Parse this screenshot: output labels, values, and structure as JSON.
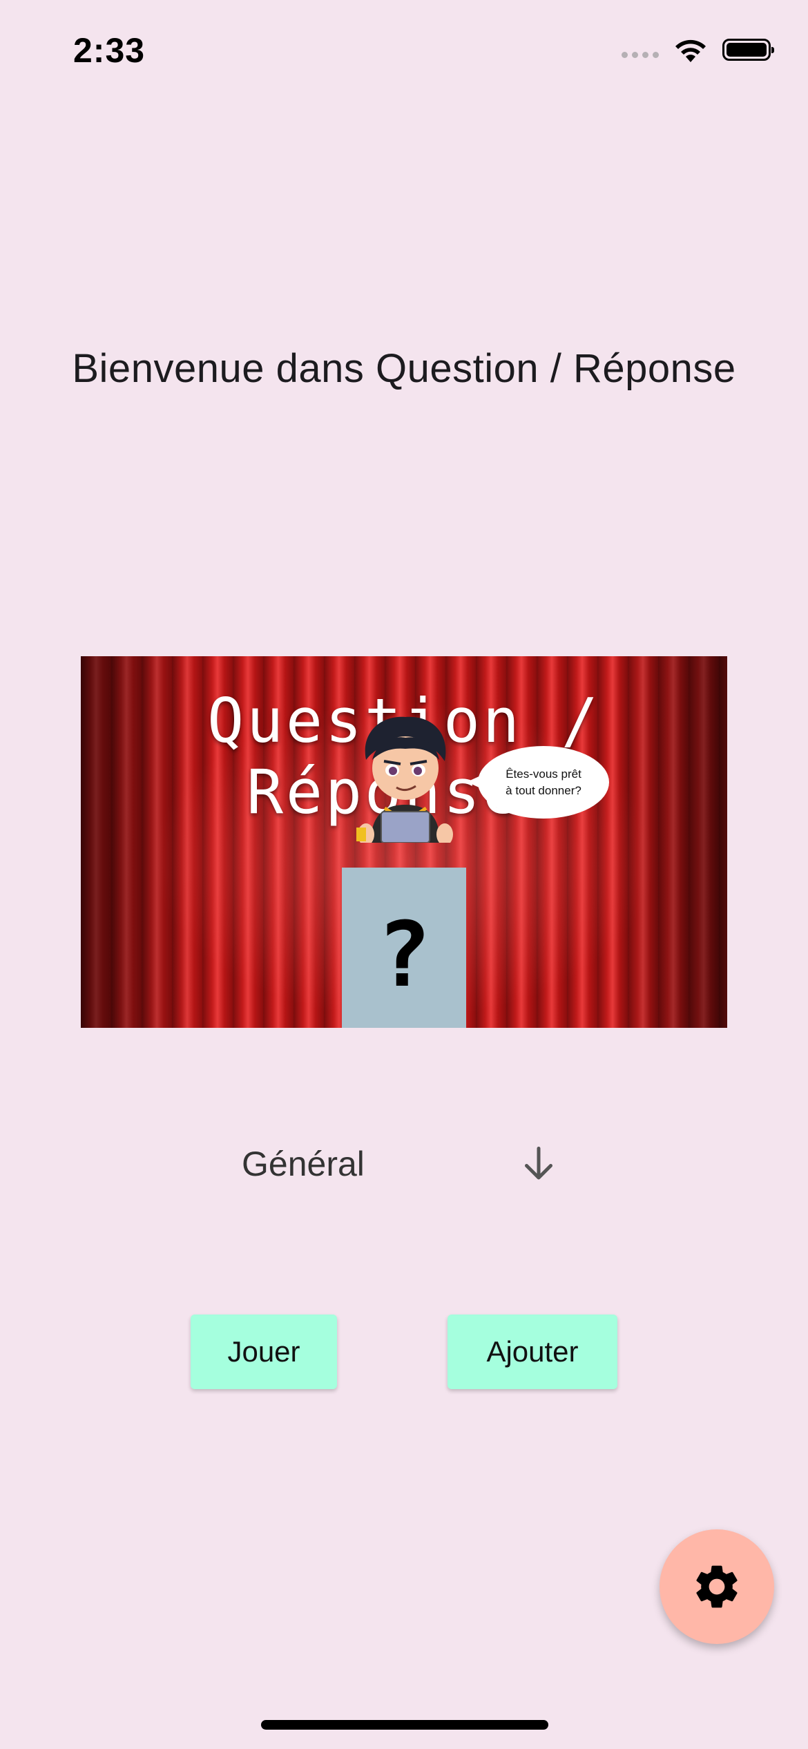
{
  "status_bar": {
    "time": "2:33"
  },
  "welcome_title": "Bienvenue dans Question / Réponse",
  "banner": {
    "title": "Question / Réponses",
    "speech_line_1": "Êtes-vous prêt",
    "speech_line_2": "à tout donner?",
    "podium_symbol": "?"
  },
  "category_dropdown": {
    "selected": "Général",
    "icon": "arrow-down-icon"
  },
  "actions": {
    "play_label": "Jouer",
    "add_label": "Ajouter"
  },
  "fab": {
    "icon": "gear-icon"
  },
  "colors": {
    "background": "#f4e4ee",
    "button": "#a5ffde",
    "fab": "#ffb7a8"
  }
}
